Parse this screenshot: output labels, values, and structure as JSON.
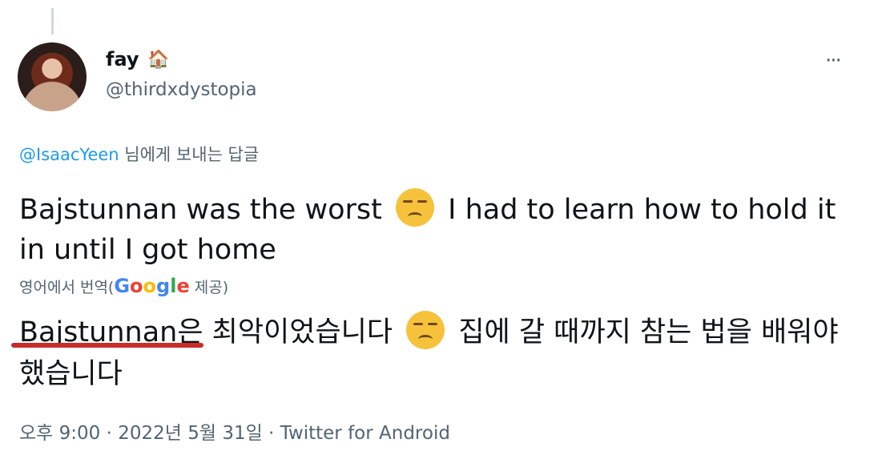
{
  "author": {
    "display_name": "fay",
    "name_emoji": "🏠",
    "handle": "@thirdxdystopia"
  },
  "menu": {
    "more_label": "···"
  },
  "reply": {
    "mention": "@IsaacYeen",
    "suffix": " 님에게 보내는 답글"
  },
  "tweet": {
    "text_before_emoji": "Bajstunnan was the worst",
    "emoji": "unamused-face-emoji",
    "text_after_emoji": "I had to learn how to hold it in until I got home"
  },
  "translation": {
    "label_prefix": "영어에서 번역(",
    "provider_logo": [
      "G",
      "o",
      "o",
      "g",
      "l",
      "e"
    ],
    "label_suffix": " 제공)",
    "text_before_emoji": "Bajstunnan은 최악이었습니다",
    "text_after_emoji": "집에 갈 때까지 참는 법을 배워야 했습니다"
  },
  "meta": {
    "timestamp": "오후 9:00 · 2022년 5월 31일 · Twitter for Android"
  },
  "colors": {
    "link": "#1d9bf0",
    "secondary_text": "#536471",
    "underline_annotation": "#c92b2b"
  }
}
